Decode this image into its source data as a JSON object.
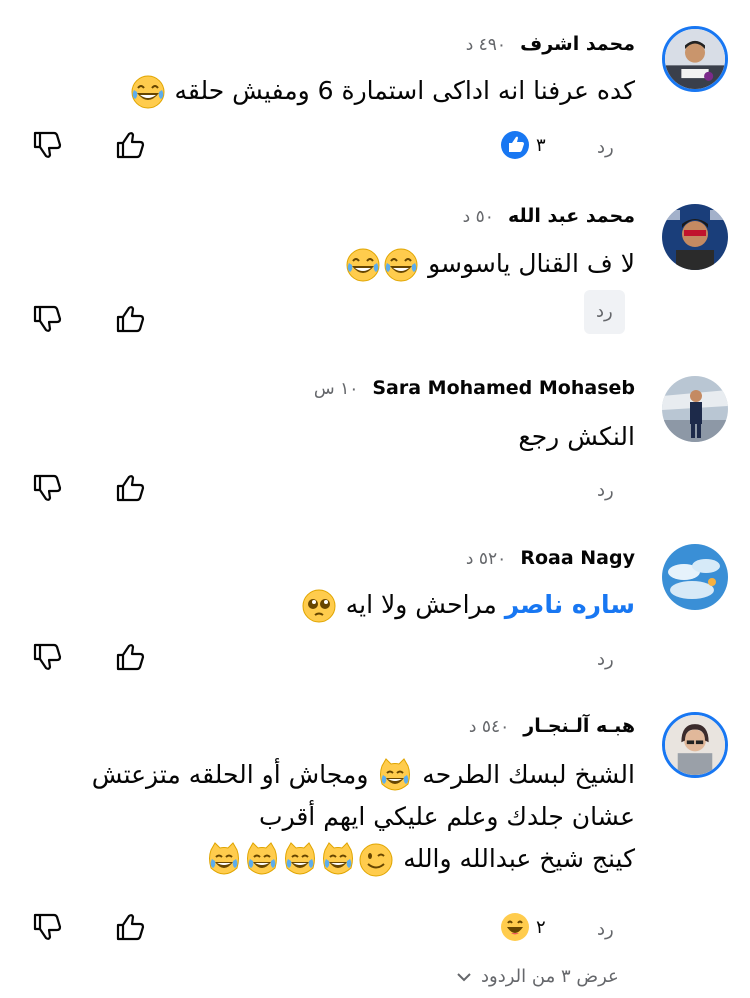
{
  "comments": [
    {
      "author": "محمد اشرف",
      "time": "٤٩٠ د",
      "text": "كده عرفنا انه اداكى استمارة 6 ومفيش حلقه",
      "emoji": [
        "laugh-tears-emoji"
      ],
      "reply_label": "رد",
      "reaction": {
        "icon": "like-reaction-icon",
        "count": "٣"
      },
      "avatar_ring": true
    },
    {
      "author": "محمد عبد الله",
      "time": "٥٠ د",
      "text": "لا ف القنال ياسوسو",
      "emoji": [
        "laugh-tears-emoji",
        "laugh-tears-emoji"
      ],
      "reply_label": "رد",
      "avatar_ring": false
    },
    {
      "author": "Sara Mohamed Mohaseb",
      "time": "١٠ س",
      "text": "النكش رجع",
      "reply_label": "رد",
      "avatar_ring": false
    },
    {
      "author": "Roaa Nagy",
      "time": "٥٢٠ د",
      "mention": "ساره ناصر",
      "text": "مراحش ولا ايه",
      "emoji": [
        "pleading-face-emoji"
      ],
      "reply_label": "رد",
      "avatar_ring": false
    },
    {
      "author": "هبـه آلـنجـار",
      "time": "٥٤٠ د",
      "lines": [
        "الشيخ لبسك الطرحه 😹 ومجاش أو الحلقه متزعتش",
        "عشان جلدك وعلم عليكي ايهم أقرب",
        "كينج شيخ عبدالله والله 😉😹😹😹😹"
      ],
      "reply_label": "رد",
      "reaction": {
        "icon": "haha-reaction-icon",
        "count": "٢"
      },
      "avatar_ring": true
    }
  ],
  "view_more": {
    "label": "عرض ٣ من الردود",
    "icon": "chevron-down-icon"
  },
  "colors": {
    "accent": "#1877f2",
    "muted": "#65676b",
    "text": "#050505"
  }
}
